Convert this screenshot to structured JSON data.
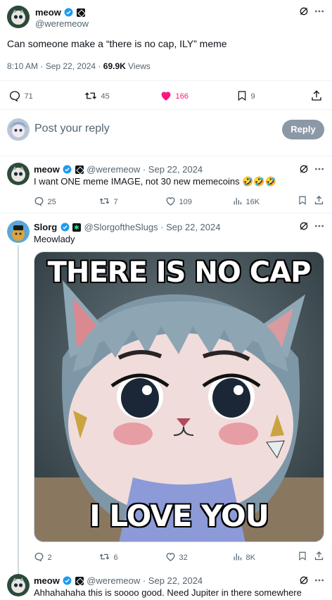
{
  "main_tweet": {
    "name": "meow",
    "handle": "@weremeow",
    "text": "Can someone make a “there is no cap, ILY” meme",
    "time": "8:10 AM · Sep 22, 2024 · ",
    "views_count": "69.9K",
    "views_label": " Views",
    "replies": "71",
    "retweets": "45",
    "likes": "166",
    "bookmarks": "9"
  },
  "reply_box": {
    "placeholder": "Post your reply",
    "button": "Reply"
  },
  "replies": [
    {
      "name": "meow",
      "handle": "@weremeow · Sep 22, 2024",
      "text": "I want ONE meme IMAGE, not 30 new memecoins 🤣🤣🤣",
      "replies": "25",
      "retweets": "7",
      "likes": "109",
      "views": "16K"
    },
    {
      "name": "Slorg",
      "handle": "@SlorgoftheSlugs · Sep 22, 2024",
      "text": "Meowlady",
      "meme_top": "THERE IS NO CAP",
      "meme_bottom": "I LOVE YOU",
      "replies": "2",
      "retweets": "6",
      "likes": "32",
      "views": "8K"
    },
    {
      "name": "meow",
      "handle": "@weremeow · Sep 22, 2024",
      "text": "Ahhahahaha this is soooo good. Need Jupiter in there somewhere"
    }
  ],
  "colors": {
    "like_active": "#f91880",
    "muted": "#536471",
    "reply_button": "#8b98a5"
  },
  "icons": [
    "grok-icon",
    "more-icon",
    "reply-icon",
    "retweet-icon",
    "heart-icon",
    "bookmark-icon",
    "share-icon",
    "views-icon",
    "verified-icon"
  ]
}
